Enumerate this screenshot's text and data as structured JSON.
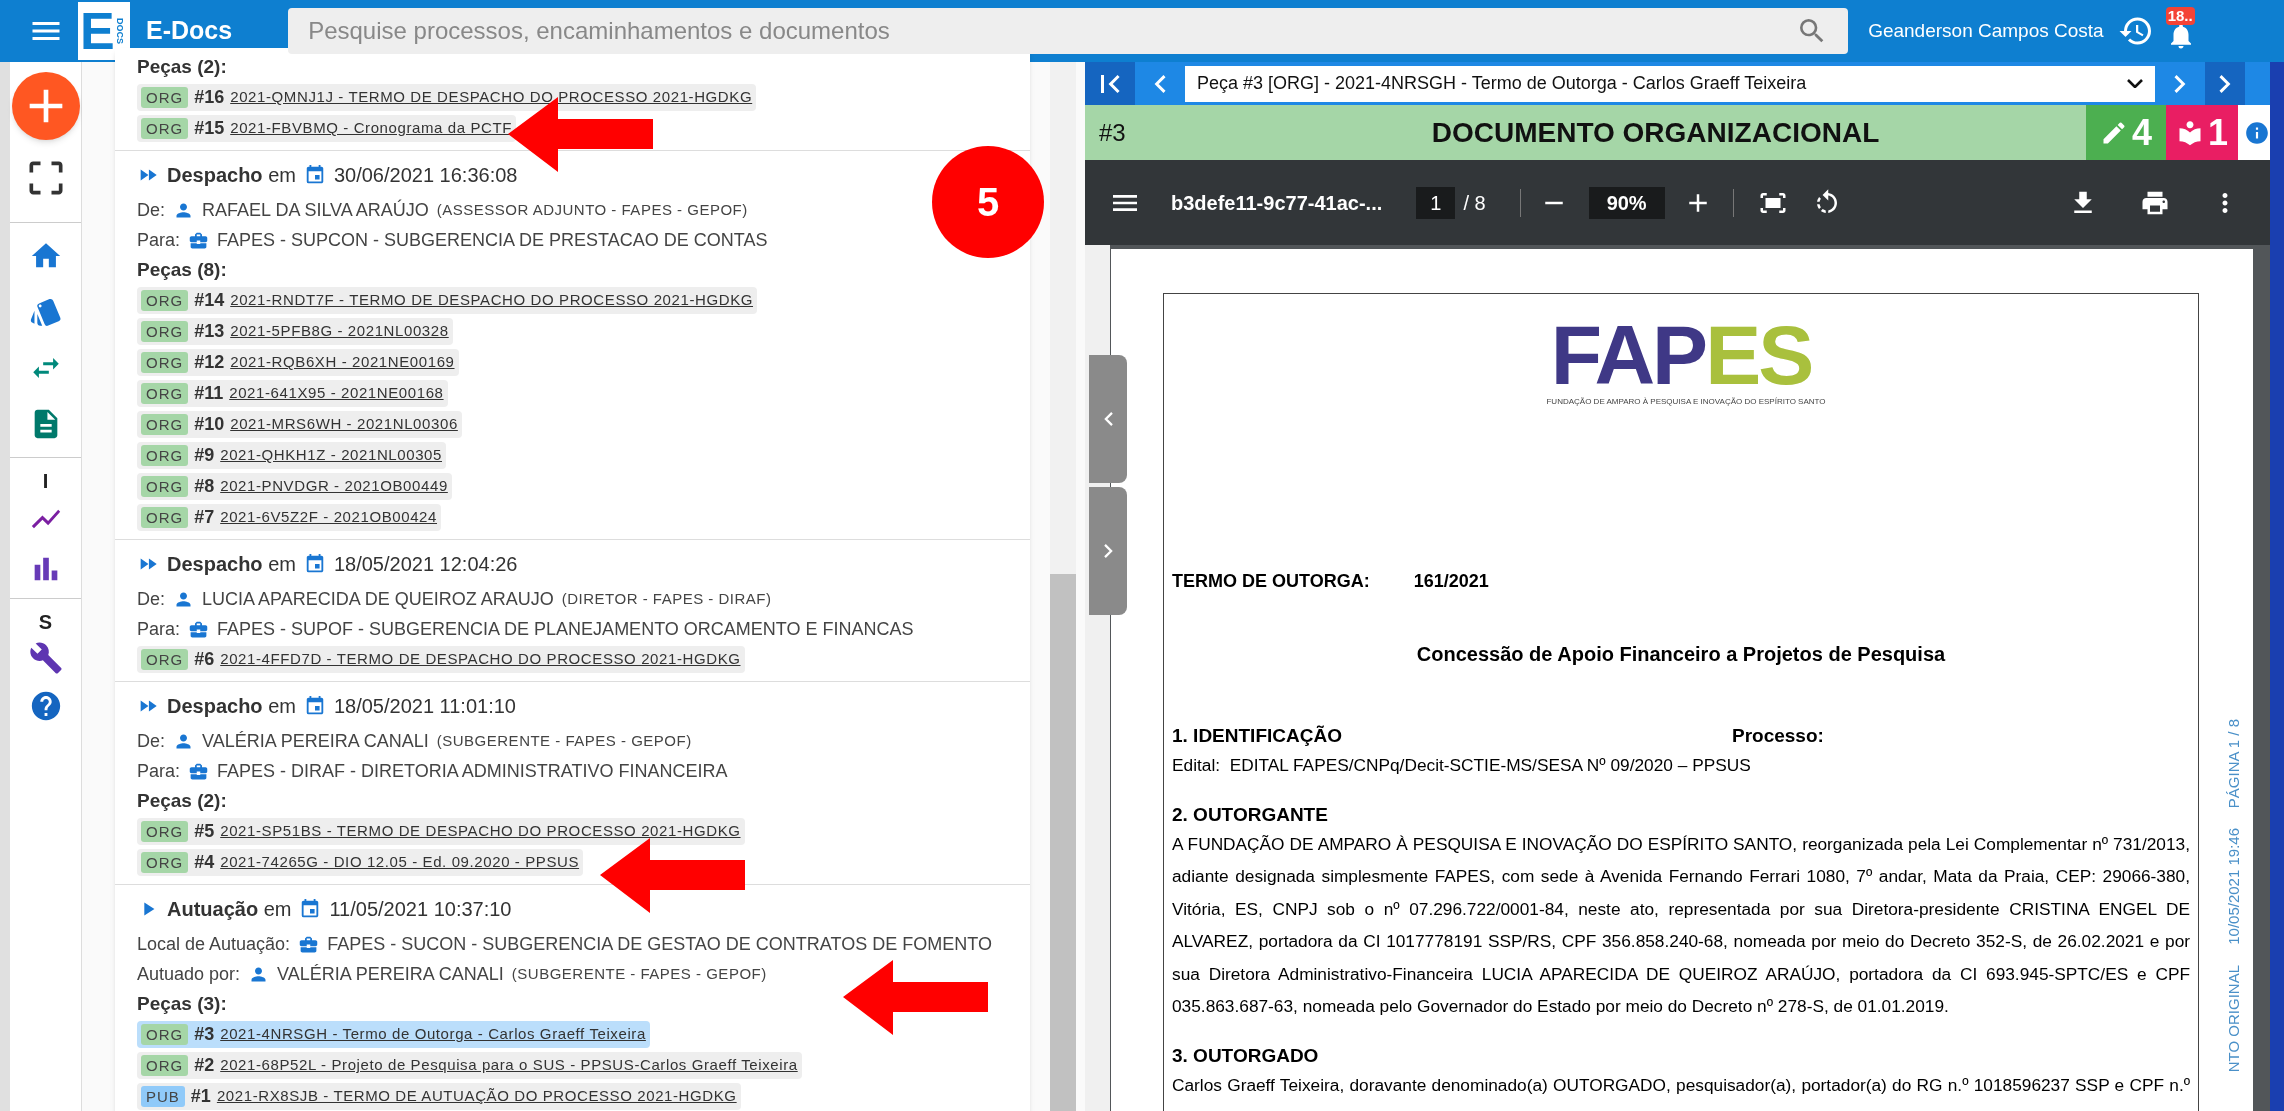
{
  "app": {
    "logo_letter": "E",
    "logo_sub": "DOCS",
    "title": "E-Docs"
  },
  "search": {
    "placeholder": "Pesquise processos, encaminhamentos e documentos"
  },
  "user": {
    "name": "Geanderson Campos Costa",
    "notifications": "18.."
  },
  "nav_labels": [
    "I",
    "S"
  ],
  "step_badge": "5",
  "events": [
    {
      "kind": "tail",
      "pieces_label": "Peças (2):",
      "pieces": [
        {
          "tag": "ORG",
          "color": "#a5d6a7",
          "number": "#16",
          "title": "2021-QMNJ1J - TERMO DE DESPACHO DO PROCESSO 2021-HGDKG",
          "selected": false
        },
        {
          "tag": "ORG",
          "color": "#a5d6a7",
          "number": "#15",
          "title": "2021-FBVBMQ - Cronograma da PCTF",
          "selected": false
        }
      ]
    },
    {
      "kind": "despacho",
      "title": "**Despacho** em",
      "date": "30/06/2021 16:36:08",
      "lines": [
        {
          "kind": "person",
          "label": "De:",
          "text": "RAFAEL DA SILVA ARAÚJO",
          "role": "(ASSESSOR ADJUNTO - FAPES - GEPOF)"
        },
        {
          "kind": "unit",
          "label": "Para:",
          "text": "FAPES - SUPCON - SUBGERENCIA DE PRESTACAO DE CONTAS"
        }
      ],
      "pieces_label": "Peças (8):",
      "pieces": [
        {
          "tag": "ORG",
          "color": "#a5d6a7",
          "number": "#14",
          "title": "2021-RNDT7F - TERMO DE DESPACHO DO PROCESSO 2021-HGDKG",
          "selected": false
        },
        {
          "tag": "ORG",
          "color": "#a5d6a7",
          "number": "#13",
          "title": "2021-5PFB8G - 2021NL00328",
          "selected": false
        },
        {
          "tag": "ORG",
          "color": "#a5d6a7",
          "number": "#12",
          "title": "2021-RQB6XH - 2021NE00169",
          "selected": false
        },
        {
          "tag": "ORG",
          "color": "#a5d6a7",
          "number": "#11",
          "title": "2021-641X95 - 2021NE00168",
          "selected": false
        },
        {
          "tag": "ORG",
          "color": "#a5d6a7",
          "number": "#10",
          "title": "2021-MRS6WH - 2021NL00306",
          "selected": false
        },
        {
          "tag": "ORG",
          "color": "#a5d6a7",
          "number": "#9",
          "title": "2021-QHKH1Z - 2021NL00305",
          "selected": false
        },
        {
          "tag": "ORG",
          "color": "#a5d6a7",
          "number": "#8",
          "title": "2021-PNVDGR - 2021OB00449",
          "selected": false
        },
        {
          "tag": "ORG",
          "color": "#a5d6a7",
          "number": "#7",
          "title": "2021-6V5Z2F - 2021OB00424",
          "selected": false
        }
      ]
    },
    {
      "kind": "despacho",
      "title": "**Despacho** em",
      "date": "18/05/2021 12:04:26",
      "lines": [
        {
          "kind": "person",
          "label": "De:",
          "text": "LUCIA APARECIDA DE QUEIROZ ARAUJO",
          "role": "(DIRETOR - FAPES - DIRAF)"
        },
        {
          "kind": "unit",
          "label": "Para:",
          "text": "FAPES - SUPOF - SUBGERENCIA DE PLANEJAMENTO ORCAMENTO E FINANCAS"
        }
      ],
      "pieces": [
        {
          "tag": "ORG",
          "color": "#a5d6a7",
          "number": "#6",
          "title": "2021-4FFD7D - TERMO DE DESPACHO DO PROCESSO 2021-HGDKG",
          "selected": false
        }
      ]
    },
    {
      "kind": "despacho",
      "title": "**Despacho** em",
      "date": "18/05/2021 11:01:10",
      "lines": [
        {
          "kind": "person",
          "label": "De:",
          "text": "VALÉRIA PEREIRA CANALI",
          "role": "(SUBGERENTE - FAPES - GEPOF)"
        },
        {
          "kind": "unit",
          "label": "Para:",
          "text": "FAPES - DIRAF - DIRETORIA ADMINISTRATIVO FINANCEIRA"
        }
      ],
      "pieces_label": "Peças (2):",
      "pieces": [
        {
          "tag": "ORG",
          "color": "#a5d6a7",
          "number": "#5",
          "title": "2021-SP51BS - TERMO DE DESPACHO DO PROCESSO 2021-HGDKG",
          "selected": false
        },
        {
          "tag": "ORG",
          "color": "#a5d6a7",
          "number": "#4",
          "title": "2021-74265G - DIO 12.05 - Ed. 09.2020 - PPSUS",
          "selected": false
        }
      ]
    },
    {
      "kind": "autuacao",
      "title": "**Autuação** em",
      "date": "11/05/2021 10:37:10",
      "lines": [
        {
          "kind": "unit",
          "label": "Local de Autuação:",
          "text": "FAPES - SUCON - SUBGERENCIA DE GESTAO DE CONTRATOS DE FOMENTO"
        },
        {
          "kind": "person",
          "label": "Autuado por:",
          "text": "VALÉRIA PEREIRA CANALI",
          "role": "(SUBGERENTE - FAPES - GEPOF)"
        }
      ],
      "pieces_label": "Peças (3):",
      "pieces": [
        {
          "tag": "ORG",
          "color": "#a5d6a7",
          "number": "#3",
          "title": "2021-4NRSGH - Termo de Outorga - Carlos Graeff Teixeira",
          "selected": true
        },
        {
          "tag": "ORG",
          "color": "#a5d6a7",
          "number": "#2",
          "title": "2021-68P52L - Projeto de Pesquisa para o SUS - PPSUS-Carlos Graeff Teixeira",
          "selected": false
        },
        {
          "tag": "PUB",
          "color": "#90caf9",
          "number": "#1",
          "title": "2021-RX8SJB - TERMO DE AUTUAÇÃO DO PROCESSO 2021-HGDKG",
          "selected": false
        }
      ]
    }
  ],
  "viewer": {
    "selected_piece": "Peça #3 [ORG] - 2021-4NRSGH - Termo de Outorga - Carlos Graeff Teixeira",
    "number": "#3",
    "title": "DOCUMENTO ORGANIZACIONAL",
    "edits": "4",
    "readers": "1",
    "file": "b3defe11-9c77-41ac-...",
    "page": "1",
    "pages": "/ 8",
    "zoom": "90%"
  },
  "document": {
    "logo_parts": [
      {
        "text": "FAP",
        "color": "#3f3886"
      },
      {
        "text": "ES",
        "color": "#a9c03d"
      }
    ],
    "logo_caption": "FUNDAÇÃO DE AMPARO À PESQUISA E INOVAÇÃO DO ESPÍRITO SANTO",
    "term_label": "TERMO DE OUTORGA:",
    "term_number": "161/2021",
    "subject": "Concessão de Apoio Financeiro a Projetos de Pesquisa",
    "sections": [
      {
        "heading": "1. IDENTIFICAÇÃO",
        "aside": "Processo:",
        "text": "Edital:  EDITAL FAPES/CNPq/Decit-SCTIE-MS/SESA Nº 09/2020 – PPSUS"
      },
      {
        "heading": "2. OUTORGANTE",
        "text": "A FUNDAÇÃO DE AMPARO À PESQUISA E INOVAÇÃO DO ESPÍRITO SANTO, reorganizada pela Lei Complementar nº 731/2013, adiante designada simplesmente FAPES, com sede à Avenida Fernando Ferrari 1080, 7º andar, Mata da Praia, CEP: 29066-380, Vitória, ES, CNPJ sob o nº 07.296.722/0001-84, neste ato, representada por sua Diretora-presidente CRISTINA ENGEL DE ALVAREZ, portadora da CI 1017778191 SSP/RS, CPF 356.858.240-68, nomeada por meio do Decreto 352-S, de 26.02.2021 e por sua Diretora Administrativo-Financeira LUCIA APARECIDA DE QUEIROZ ARAÚJO, portadora da CI 693.945-SPTC/ES e CPF 035.863.687-63, nomeada pelo Governador do Estado por meio do Decreto nº 278-S, de 01.01.2019."
      },
      {
        "heading": "3. OUTORGADO",
        "text": "Carlos Graeff Teixeira, doravante denominado(a) OUTORGADO, pesquisador(a), portador(a) do RG n.º 1018596237 SSP e CPF n.º"
      }
    ],
    "stamp": [
      "PÁGINA 1 / 8",
      "10/05/2021 19:46",
      "NTO ORIGINAL"
    ]
  }
}
